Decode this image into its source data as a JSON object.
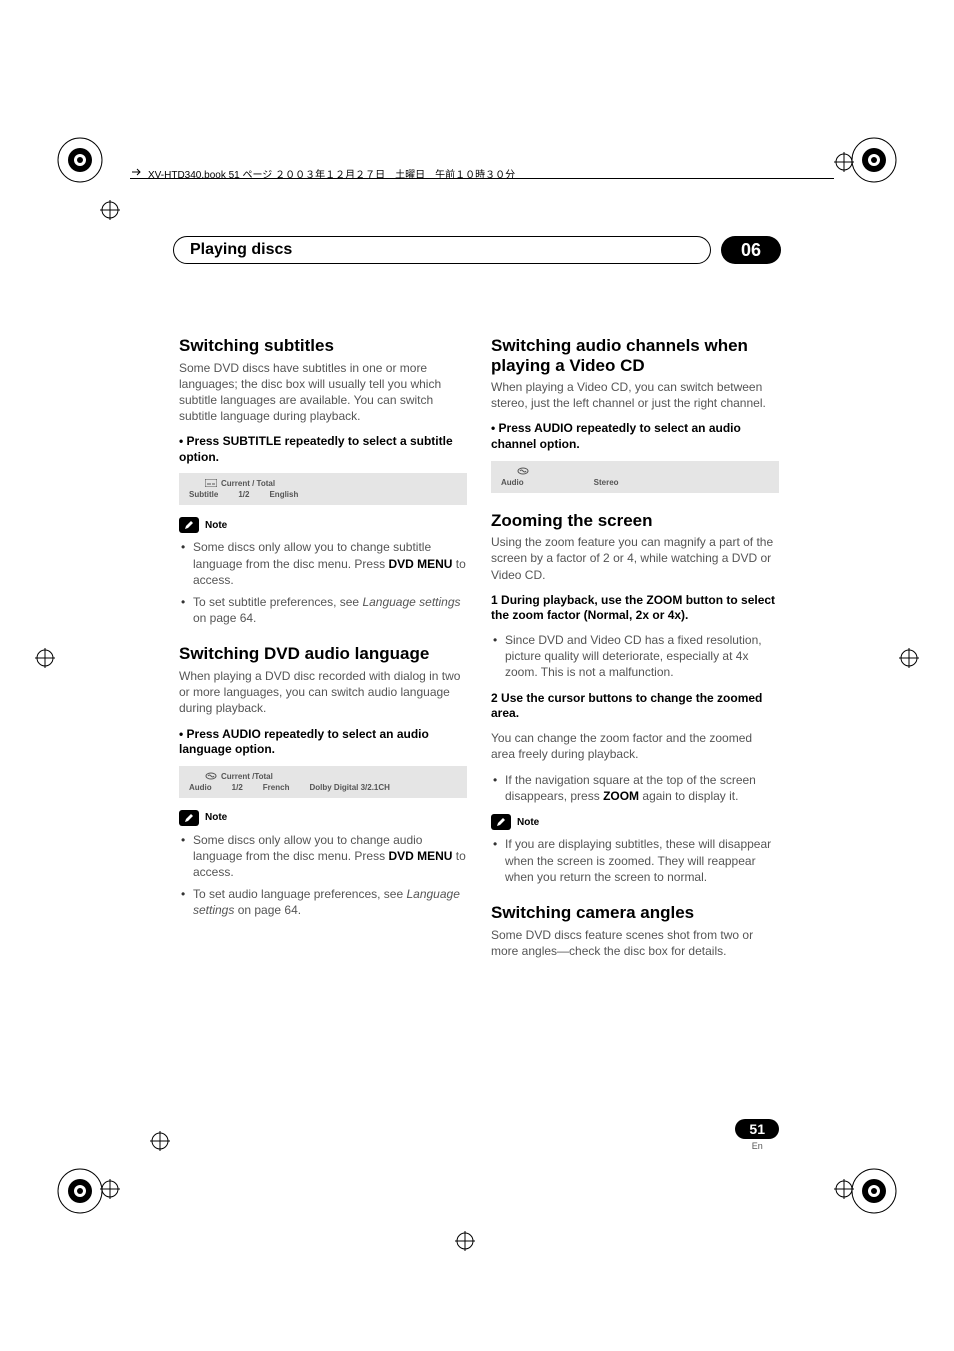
{
  "header_line": "XV-HTD340.book  51 ページ  ２００３年１２月２７日　土曜日　午前１０時３０分",
  "pill": {
    "title": "Playing discs",
    "chapter": "06"
  },
  "left": {
    "s1": {
      "h": "Switching subtitles",
      "p": "Some DVD discs have subtitles in one or more languages; the disc box will usually tell you which subtitle languages are available. You can switch subtitle language during playback.",
      "step": "•    Press SUBTITLE repeatedly to select a subtitle option.",
      "disp_top": "Current / Total",
      "disp_l1": "Subtitle",
      "disp_l2": "1/2",
      "disp_l3": "English",
      "note": "Note",
      "li1a": "Some discs only allow you to change subtitle language from the disc menu. Press ",
      "li1b": "DVD MENU",
      "li1c": " to access.",
      "li2a": "To set subtitle preferences, see ",
      "li2b": "Language settings",
      "li2c": " on page 64."
    },
    "s2": {
      "h": "Switching DVD audio language",
      "p": "When playing a DVD disc recorded with dialog in two or more languages, you can switch audio language during playback.",
      "step": "•    Press AUDIO repeatedly to select an audio language option.",
      "disp_top": "Current /Total",
      "disp_l1": "Audio",
      "disp_l2": "1/2",
      "disp_l3": "French",
      "disp_l4": "Dolby Digital 3/2.1CH",
      "note": "Note",
      "li1a": "Some discs only allow you to change audio language from the disc menu. Press ",
      "li1b": "DVD MENU",
      "li1c": " to access.",
      "li2a": "To set audio language preferences, see ",
      "li2b": "Language settings",
      "li2c": " on page 64."
    }
  },
  "right": {
    "s1": {
      "h": "Switching audio channels when playing a Video CD",
      "p": "When playing a Video CD, you can switch between stereo, just the left channel or just the right channel.",
      "step": "•    Press AUDIO repeatedly to select an audio channel option.",
      "disp_l1": "Audio",
      "disp_l2": "Stereo"
    },
    "s2": {
      "h": "Zooming the screen",
      "p": "Using the zoom feature you can magnify a part of the screen by a factor of 2 or 4, while watching a DVD or Video CD.",
      "step1n": "1",
      "step1": "    During playback, use the ZOOM button to select the zoom factor (Normal, 2x or 4x).",
      "li1": "Since DVD and Video CD has a fixed resolution, picture quality will deteriorate, especially at 4x zoom. This is not a malfunction.",
      "step2n": "2",
      "step2": "    Use the cursor buttons to change the zoomed area.",
      "p2": "You can change the zoom factor and the zoomed area freely during playback.",
      "li2a": "If the navigation square at the top of the screen disappears, press ",
      "li2b": "ZOOM",
      "li2c": " again to display it.",
      "note": "Note",
      "li3": "If you are displaying subtitles, these will disappear when the screen is zoomed. They will reappear when you return the screen to normal."
    },
    "s3": {
      "h": "Switching camera angles",
      "p": "Some DVD discs feature scenes shot from two or more angles—check the disc box for details."
    }
  },
  "page": {
    "num": "51",
    "lang": "En"
  }
}
